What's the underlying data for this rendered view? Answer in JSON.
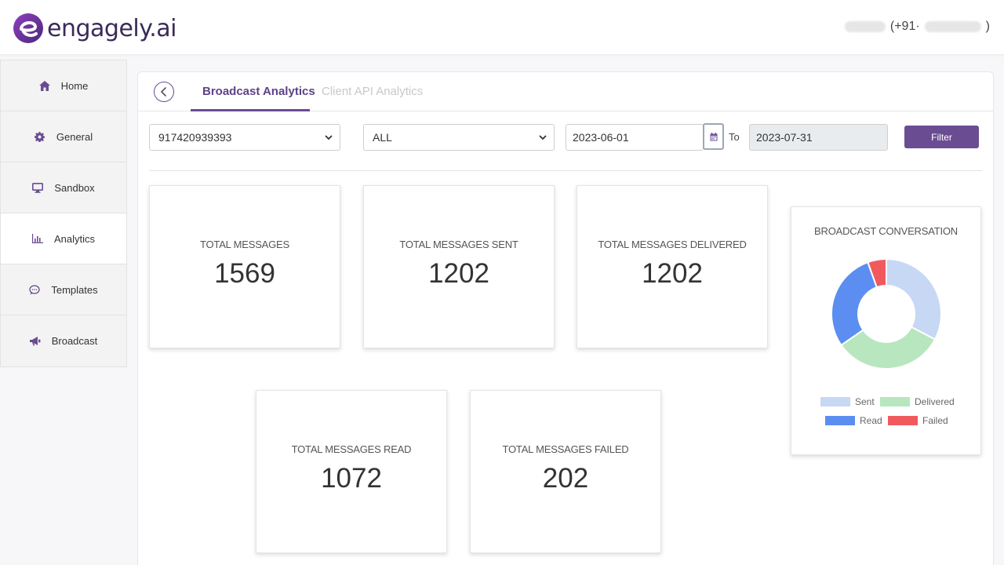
{
  "header": {
    "logo_text": "engagely.ai",
    "user_prefix": "(+91·",
    "user_suffix": ")"
  },
  "sidebar": {
    "items": [
      {
        "label": "Home",
        "icon": "home-icon"
      },
      {
        "label": "General",
        "icon": "gear-icon"
      },
      {
        "label": "Sandbox",
        "icon": "monitor-icon"
      },
      {
        "label": "Analytics",
        "icon": "bar-chart-icon"
      },
      {
        "label": "Templates",
        "icon": "speech-bubble-icon"
      },
      {
        "label": "Broadcast",
        "icon": "megaphone-icon"
      }
    ],
    "active_index": 3
  },
  "tabs": {
    "broadcast": "Broadcast Analytics",
    "client_api": "Client API Analytics"
  },
  "filters": {
    "phone": "917420939393",
    "type": "ALL",
    "from_date": "2023-06-01",
    "to_label": "To",
    "to_date": "2023-07-31",
    "filter_button": "Filter"
  },
  "stats": [
    {
      "title": "TOTAL MESSAGES",
      "value": "1569"
    },
    {
      "title": "TOTAL MESSAGES SENT",
      "value": "1202"
    },
    {
      "title": "TOTAL MESSAGES DELIVERED",
      "value": "1202"
    },
    {
      "title": "TOTAL MESSAGES READ",
      "value": "1072"
    },
    {
      "title": "TOTAL MESSAGES FAILED",
      "value": "202"
    }
  ],
  "colors": {
    "brand": "#6a4c93",
    "sent": "#c7d8f5",
    "delivered": "#b8e6bf",
    "read": "#5b8ef0",
    "failed": "#f05a5f"
  },
  "chart_data": {
    "type": "pie",
    "title": "BROADCAST CONVERSATION",
    "categories": [
      "Sent",
      "Delivered",
      "Read",
      "Failed"
    ],
    "values": [
      1202,
      1202,
      1072,
      202
    ],
    "colors": [
      "#c7d8f5",
      "#b8e6bf",
      "#5b8ef0",
      "#f05a5f"
    ],
    "donut": true,
    "legend_position": "bottom"
  }
}
